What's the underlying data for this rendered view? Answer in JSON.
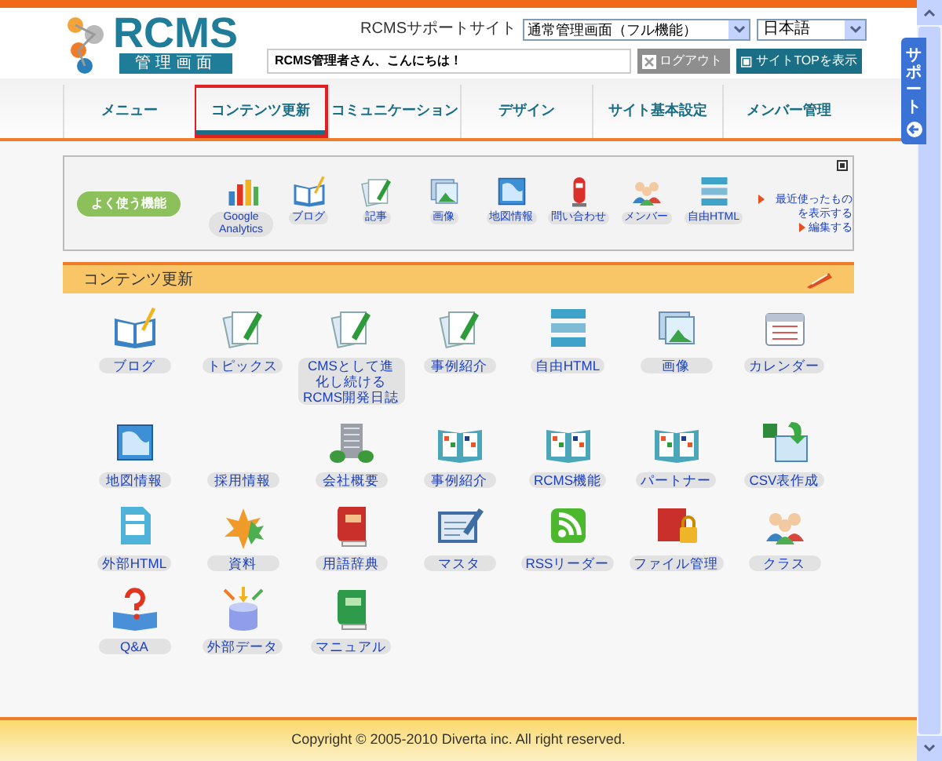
{
  "header": {
    "logo": {
      "name": "RCMS",
      "subtitle": "管理画面"
    },
    "support_label": "RCMSサポートサイト",
    "mode_select": {
      "value": "通常管理画面（フル機能）"
    },
    "language_select": {
      "value": "日本語"
    },
    "greeting": "RCMS管理者さん、こんにちは！",
    "logout_button": {
      "label": "ログアウト",
      "disabled": true
    },
    "site_top_button": "サイトTOPを表示"
  },
  "nav_tabs": [
    {
      "label": "メニュー",
      "selected": false
    },
    {
      "label": "コンテンツ更新",
      "selected": true
    },
    {
      "label": "コミュニケーション",
      "selected": false
    },
    {
      "label": "デザイン",
      "selected": false
    },
    {
      "label": "サイト基本設定",
      "selected": false
    },
    {
      "label": "メンバー管理",
      "selected": false
    }
  ],
  "favorites": {
    "title": "よく使う機能",
    "items": [
      "Google Analytics",
      "ブログ",
      "記事",
      "画像",
      "地図情報",
      "問い合わせ",
      "メンバー",
      "自由HTML"
    ],
    "links": [
      "最近使ったものを表示する",
      "編集する"
    ]
  },
  "section": {
    "title": "コンテンツ更新",
    "items": [
      "ブログ",
      "トピックス",
      "CMSとして進化し続けるRCMS開発日誌",
      "事例紹介",
      "自由HTML",
      "画像",
      "カレンダー",
      "地図情報",
      "採用情報",
      "会社概要",
      "事例紹介",
      "RCMS機能",
      "パートナー",
      "CSV表作成",
      "外部HTML",
      "資料",
      "用語辞典",
      "マスタ",
      "RSSリーダー",
      "ファイル管理",
      "クラス",
      "Q&A",
      "外部データ",
      "マニュアル"
    ]
  },
  "side_tab": "サポート",
  "footer": "Copyright © 2005-2010 Diverta inc. All right reserved."
}
